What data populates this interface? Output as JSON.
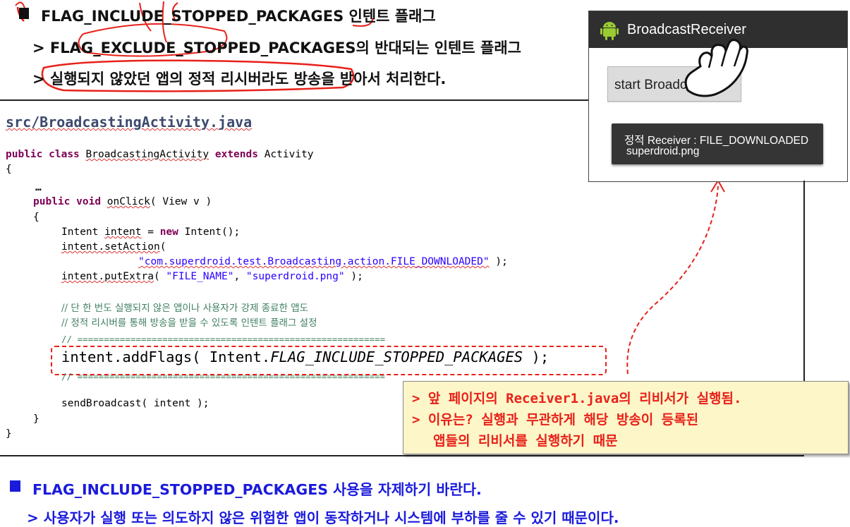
{
  "header": {
    "line1": "FLAG_INCLUDE_STOPPED_PACKAGES 인텐트 플래그",
    "line2": "> FLAG_EXCLUDE_STOPPED_PACKAGES의 반대되는 인텐트 플래그",
    "line3_prefix": "> ",
    "line3_circled": "실행되지 않았던 앱의 정적 리시버라도",
    "line3_rest": " 방송을 받아서 처리한다."
  },
  "phone": {
    "app_title": "BroadcastReceiver",
    "button_label": "start Broadcasting",
    "toast_line1": "정적 Receiver : FILE_DOWNLOADED",
    "toast_line2": "superdroid.png"
  },
  "code": {
    "filename": "src/BroadcastingActivity.java",
    "class_public": "public",
    "class_class": "class",
    "class_name": "BroadcastingActivity",
    "class_extends": "extends",
    "class_parent": "Activity",
    "open_brace": "{",
    "ellipsis": "…",
    "method_public": "public",
    "method_void": "void",
    "method_name": "onClick",
    "method_params": "( View v )",
    "method_open": "{",
    "l1_type": "Intent ",
    "l1_var": "intent",
    "l1_eq": " = ",
    "l1_new": "new",
    "l1_rest": " Intent();",
    "l2_var": "intent.setAction",
    "l2_paren": "(",
    "l3_string": "\"com.superdroid.test.Broadcasting.action.FILE_DOWNLOADED\"",
    "l3_close": " );",
    "l4_var": "intent.putExtra",
    "l4_paren": "( ",
    "l4_str1": "\"FILE_NAME\"",
    "l4_comma": ", ",
    "l4_str2": "\"superdroid.png\"",
    "l4_close": " );",
    "comment1": "// 단 한 번도 실행되지 않은 앱이나 사용자가 강제 종료한 앱도",
    "comment2": "// 정적 리시버를 통해 방송을 받을 수 있도록 인텐트 플래그 설정",
    "comment_sep": "// ==========================================================",
    "flags_a": "intent.addFlags( Intent.",
    "flags_b": "FLAG_INCLUDE_STOPPED_PACKAGES",
    "flags_c": " );",
    "comment_sep2": "// ==========================================================",
    "send": "sendBroadcast( intent );",
    "method_close": "}",
    "class_close": "}"
  },
  "notice": {
    "line1": "> 앞 페이지의 Receiver1.java의 리비서가 실행됨.",
    "line2": "> 이유는? 실행과 무관하게 해당 방송이 등록된",
    "line3": "앱들의 리비서를 실행하기 때문"
  },
  "footer": {
    "line1": "FLAG_INCLUDE_STOPPED_PACKAGES 사용을 자제하기 바란다.",
    "line2": "> 사용자가 실행 또는 의도하지 않은 위험한 앱이 동작하거나 시스템에 부하를 줄 수 있기 때문이다."
  },
  "colors": {
    "accent_blue": "#1a1adc",
    "annotation_red": "#e8211a",
    "keyword": "#7f0055",
    "string": "#2a00ff",
    "comment": "#3f7f5f",
    "notice_bg": "#fdf6c9"
  },
  "icons": [
    "square-bullet-icon",
    "android-robot-icon",
    "hand-pointer-icon"
  ]
}
